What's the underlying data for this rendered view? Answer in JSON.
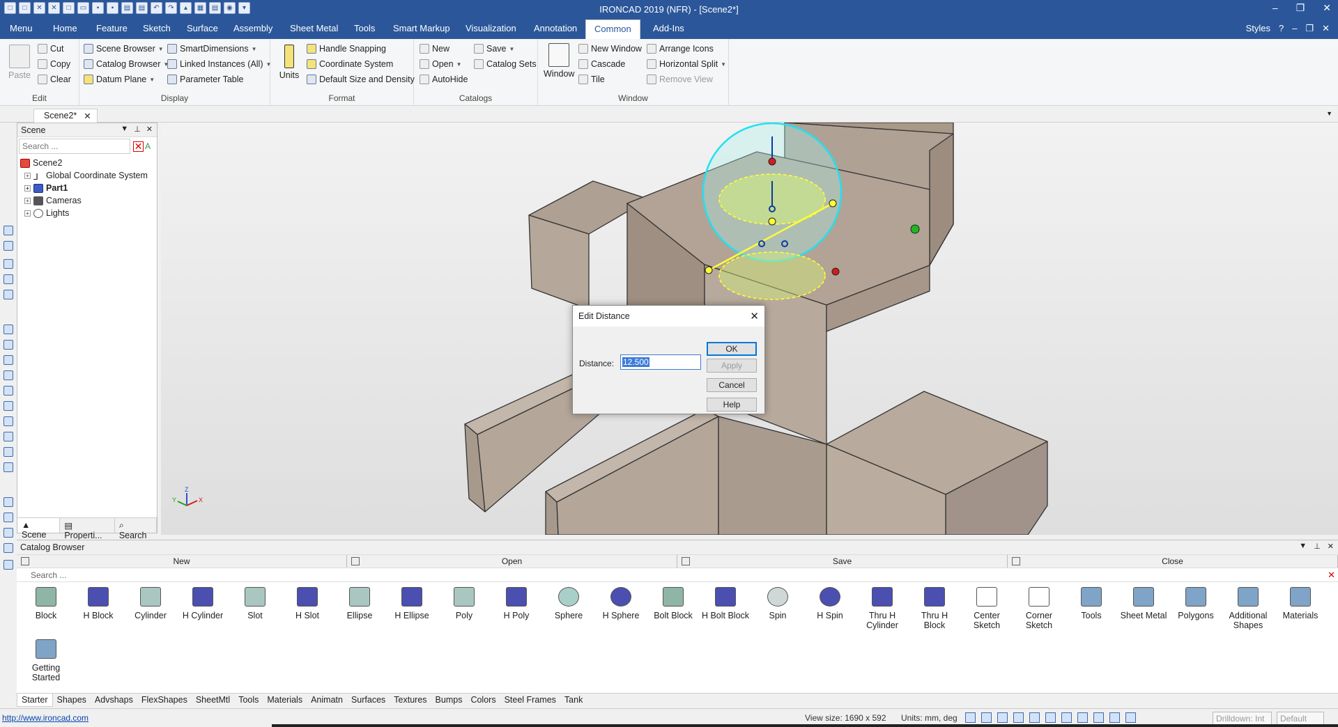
{
  "window": {
    "title": "IRONCAD 2019 (NFR) - [Scene2*]",
    "controls": [
      "–",
      "❐",
      "✕"
    ]
  },
  "menu": {
    "tabs": [
      "Menu",
      "Home",
      "Feature",
      "Sketch",
      "Surface",
      "Assembly",
      "Sheet Metal",
      "Tools",
      "Smart Markup",
      "Visualization",
      "Annotation",
      "Common",
      "Add-Ins"
    ],
    "active": "Common",
    "styles_label": "Styles"
  },
  "ribbon": {
    "edit": {
      "label": "Edit",
      "paste": "Paste",
      "cut": "Cut",
      "copy": "Copy",
      "clear": "Clear"
    },
    "display": {
      "label": "Display",
      "scene_browser": "Scene Browser",
      "catalog_browser": "Catalog Browser",
      "datum_plane": "Datum Plane",
      "smart_dimensions": "SmartDimensions",
      "linked_instances": "Linked Instances (All)",
      "parameter_table": "Parameter Table"
    },
    "format": {
      "label": "Format",
      "units": "Units",
      "handle_snapping": "Handle Snapping",
      "coordinate_system": "Coordinate System",
      "default_size": "Default Size and Density"
    },
    "catalogs": {
      "label": "Catalogs",
      "new": "New",
      "open": "Open",
      "autohide": "AutoHide",
      "save": "Save",
      "catalog_sets": "Catalog Sets"
    },
    "window": {
      "label": "Window",
      "window": "Window",
      "new_window": "New Window",
      "cascade": "Cascade",
      "tile": "Tile",
      "arrange_icons": "Arrange Icons",
      "horizontal_split": "Horizontal Split",
      "remove_view": "Remove View"
    }
  },
  "doc_tab": {
    "label": "Scene2*",
    "close": "✕"
  },
  "scene_panel": {
    "title": "Scene",
    "search_placeholder": "Search ...",
    "tree": {
      "root": "Scene2",
      "children": [
        "Global Coordinate System",
        "Part1",
        "Cameras",
        "Lights"
      ]
    },
    "tabs": [
      "Scene",
      "Properti...",
      "Search"
    ]
  },
  "viewport": {
    "triad_labels": {
      "x": "X",
      "y": "Y",
      "z": "Z"
    }
  },
  "dialog": {
    "title": "Edit Distance",
    "field_label": "Distance:",
    "field_value": "12.500",
    "buttons": {
      "ok": "OK",
      "apply": "Apply",
      "cancel": "Cancel",
      "help": "Help"
    }
  },
  "catalog": {
    "title": "Catalog Browser",
    "actions": [
      "New",
      "Open",
      "Save",
      "Close"
    ],
    "search_placeholder": "Search ...",
    "items": [
      {
        "label": "Block",
        "icon": "block-icon",
        "color": "#8fb5a6"
      },
      {
        "label": "H Block",
        "icon": "h-block-icon",
        "color": "#4b4fb0"
      },
      {
        "label": "Cylinder",
        "icon": "cylinder-icon",
        "color": "#a9c7c0"
      },
      {
        "label": "H Cylinder",
        "icon": "h-cylinder-icon",
        "color": "#4b4fb0"
      },
      {
        "label": "Slot",
        "icon": "slot-icon",
        "color": "#a9c7c0"
      },
      {
        "label": "H Slot",
        "icon": "h-slot-icon",
        "color": "#4b4fb0"
      },
      {
        "label": "Ellipse",
        "icon": "ellipse-icon",
        "color": "#a9c7c0"
      },
      {
        "label": "H Ellipse",
        "icon": "h-ellipse-icon",
        "color": "#4b4fb0"
      },
      {
        "label": "Poly",
        "icon": "poly-icon",
        "color": "#a9c7c0"
      },
      {
        "label": "H Poly",
        "icon": "h-poly-icon",
        "color": "#4b4fb0"
      },
      {
        "label": "Sphere",
        "icon": "sphere-icon",
        "color": "#a9d0c8"
      },
      {
        "label": "H Sphere",
        "icon": "h-sphere-icon",
        "color": "#4b4fb0"
      },
      {
        "label": "Bolt Block",
        "icon": "bolt-block-icon",
        "color": "#8fb5a6"
      },
      {
        "label": "H Bolt Block",
        "icon": "h-bolt-block-icon",
        "color": "#4b4fb0"
      },
      {
        "label": "Spin",
        "icon": "spin-icon",
        "color": "#cfd8d6"
      },
      {
        "label": "H Spin",
        "icon": "h-spin-icon",
        "color": "#4b4fb0"
      },
      {
        "label": "Thru H Cylinder",
        "icon": "thru-h-cylinder-icon",
        "color": "#4b4fb0"
      },
      {
        "label": "Thru H Block",
        "icon": "thru-h-block-icon",
        "color": "#4b4fb0"
      },
      {
        "label": "Center Sketch",
        "icon": "center-sketch-icon",
        "color": "#ffffff"
      },
      {
        "label": "Corner Sketch",
        "icon": "corner-sketch-icon",
        "color": "#ffffff"
      },
      {
        "label": "Tools",
        "icon": "folder-icon",
        "color": "#7fa4c7"
      },
      {
        "label": "Sheet Metal",
        "icon": "folder-icon",
        "color": "#7fa4c7"
      },
      {
        "label": "Polygons",
        "icon": "folder-icon",
        "color": "#7fa4c7"
      },
      {
        "label": "Additional Shapes",
        "icon": "folder-icon",
        "color": "#7fa4c7"
      },
      {
        "label": "Materials",
        "icon": "folder-icon",
        "color": "#7fa4c7"
      },
      {
        "label": "Getting Started",
        "icon": "folder-icon",
        "color": "#7fa4c7"
      }
    ],
    "tabs": [
      "Starter",
      "Shapes",
      "Advshaps",
      "FlexShapes",
      "SheetMtl",
      "Tools",
      "Materials",
      "Animatn",
      "Surfaces",
      "Textures",
      "Bumps",
      "Colors",
      "Steel Frames",
      "Tank"
    ],
    "active_tab": "Starter"
  },
  "status": {
    "link": "http://www.ironcad.com",
    "view_size": "View size: 1690 x 592",
    "units": "Units: mm, deg",
    "drilldown": "Drilldown: Int",
    "style": "Default"
  },
  "colors": {
    "accent": "#2b579a",
    "part": "#b2a396",
    "handle": "#22e0f0",
    "highlight": "#ffff33"
  }
}
